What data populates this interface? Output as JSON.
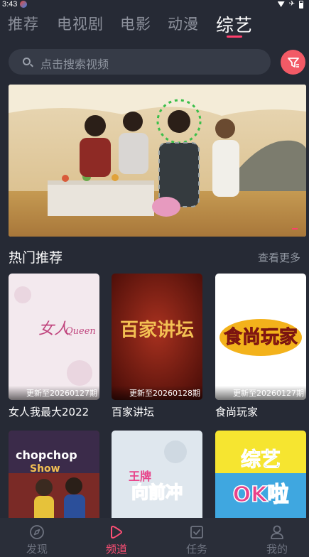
{
  "status_bar": {
    "time": "3:43"
  },
  "tabs": [
    {
      "label": "推荐"
    },
    {
      "label": "电视剧"
    },
    {
      "label": "电影"
    },
    {
      "label": "动漫"
    },
    {
      "label": "综艺"
    }
  ],
  "active_tab": "综艺",
  "search": {
    "placeholder": "点击搜索视频"
  },
  "section": {
    "title": "热门推荐",
    "more": "查看更多"
  },
  "cards": [
    {
      "title": "女人我最大2022",
      "update": "更新至20260127期",
      "poster_text": "女人我最大 Queen"
    },
    {
      "title": "百家讲坛",
      "update": "更新至20260128期",
      "poster_text": "百家讲坛"
    },
    {
      "title": "食尚玩家",
      "update": "更新至20260127期",
      "poster_text": "食尚玩家"
    },
    {
      "title": "",
      "update": "",
      "poster_text": "chopchop Show"
    },
    {
      "title": "",
      "update": "",
      "poster_text": "王牌向前冲"
    },
    {
      "title": "",
      "update": "",
      "poster_text": "综艺OK啦"
    }
  ],
  "bottom_nav": [
    {
      "label": "发现",
      "icon": "compass-icon"
    },
    {
      "label": "频道",
      "icon": "play-icon"
    },
    {
      "label": "任务",
      "icon": "task-icon"
    },
    {
      "label": "我的",
      "icon": "user-icon"
    }
  ],
  "colors": {
    "accent": "#ff3f6c",
    "background": "#262a35",
    "filter_button": "#f25a66"
  }
}
